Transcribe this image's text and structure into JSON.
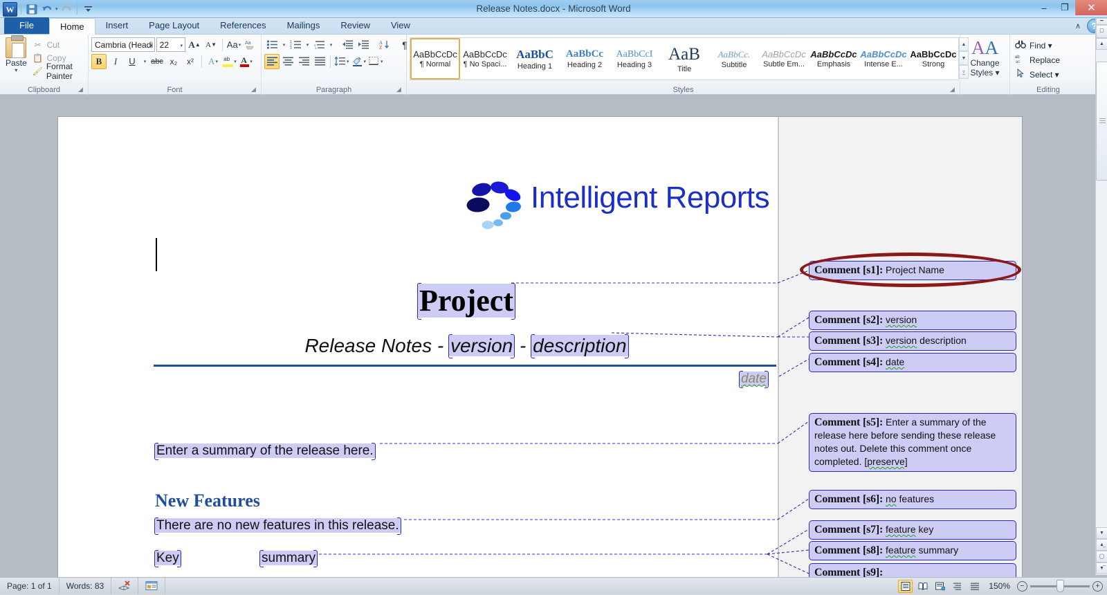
{
  "window": {
    "title": "Release Notes.docx  -  Microsoft Word",
    "minimize": "–",
    "restore": "❐",
    "close": "✕",
    "help": "?",
    "collapse_ribbon": "∧"
  },
  "quick_access": {
    "app_logo": "W",
    "save": "save-icon",
    "undo": "undo-icon",
    "redo": "redo-icon",
    "customize": "customize-icon"
  },
  "tabs": [
    {
      "label": "File",
      "kind": "file"
    },
    {
      "label": "Home",
      "kind": "active"
    },
    {
      "label": "Insert",
      "kind": "normal"
    },
    {
      "label": "Page Layout",
      "kind": "normal"
    },
    {
      "label": "References",
      "kind": "normal"
    },
    {
      "label": "Mailings",
      "kind": "normal"
    },
    {
      "label": "Review",
      "kind": "normal"
    },
    {
      "label": "View",
      "kind": "normal"
    }
  ],
  "ribbon": {
    "clipboard": {
      "group_label": "Clipboard",
      "paste": "Paste",
      "paste_arrow": "▾",
      "cut": "Cut",
      "copy": "Copy",
      "format_painter": "Format Painter"
    },
    "font": {
      "group_label": "Font",
      "font_name": "Cambria (Headi",
      "font_size": "22",
      "grow_font": "A",
      "shrink_font": "A",
      "change_case": "Aa",
      "clear_formatting": "clear-formatting-icon",
      "bold": "B",
      "italic": "I",
      "underline": "U",
      "strikethrough": "abc",
      "subscript": "x₂",
      "superscript": "x²",
      "text_effects": "A",
      "highlight": "ab",
      "font_color": "A"
    },
    "paragraph": {
      "group_label": "Paragraph",
      "bullets": "bullets-icon",
      "numbering": "numbering-icon",
      "multilevel": "multilevel-list-icon",
      "decrease_indent": "decrease-indent-icon",
      "increase_indent": "increase-indent-icon",
      "sort": "sort-icon",
      "show_marks": "¶",
      "align_left": "align-left-icon",
      "align_center": "align-center-icon",
      "align_right": "align-right-icon",
      "justify": "justify-icon",
      "line_spacing": "line-spacing-icon",
      "shading": "shading-icon",
      "borders": "borders-icon"
    },
    "styles": {
      "group_label": "Styles",
      "items": [
        {
          "preview": "AaBbCcDc",
          "name": "¶ Normal",
          "selected": true
        },
        {
          "preview": "AaBbCcDc",
          "name": "¶ No Spaci...",
          "selected": false
        },
        {
          "preview": "AaBbC",
          "name": "Heading 1",
          "selected": false
        },
        {
          "preview": "AaBbCc",
          "name": "Heading 2",
          "selected": false
        },
        {
          "preview": "AaBbCcI",
          "name": "Heading 3",
          "selected": false
        },
        {
          "preview": "AaB",
          "name": "Title",
          "selected": false
        },
        {
          "preview": "AaBbCc.",
          "name": "Subtitle",
          "selected": false
        },
        {
          "preview": "AaBbCcDc",
          "name": "Subtle Em...",
          "selected": false
        },
        {
          "preview": "AaBbCcDc",
          "name": "Emphasis",
          "selected": false
        },
        {
          "preview": "AaBbCcDc",
          "name": "Intense E...",
          "selected": false
        },
        {
          "preview": "AaBbCcDc",
          "name": "Strong",
          "selected": false
        }
      ],
      "change_styles": "Change\nStyles"
    },
    "change_styles": {
      "line1": "Change",
      "line2": "Styles ▾"
    },
    "editing": {
      "group_label": "Editing",
      "find": "Find ▾",
      "replace": "Replace",
      "select": "Select ▾"
    }
  },
  "document": {
    "logo_text": "Intelligent Reports",
    "title": "Project",
    "subtitle_pre": "Release Notes - ",
    "subtitle_version": "version",
    "subtitle_mid": " - ",
    "subtitle_description": "description",
    "date": "date",
    "summary": "Enter a summary of the release here.",
    "heading_new_features": "New Features",
    "no_features": "There are no new features in this release.",
    "key": "Key",
    "summary_col": "summary"
  },
  "comments": [
    {
      "label": "Comment [s1]:",
      "text": "Project Name",
      "squiggle": ""
    },
    {
      "label": "Comment [s2]:",
      "text": "",
      "squiggle": "version"
    },
    {
      "label": "Comment [s3]:",
      "text": " description",
      "squiggle": "version"
    },
    {
      "label": "Comment [s4]:",
      "text": "",
      "squiggle": "date"
    },
    {
      "label": "Comment [s5]:",
      "text": "Enter a summary of the release here before sending these release notes out.  Delete this comment once completed.",
      "squiggle": "[preserve]"
    },
    {
      "label": "Comment [s6]:",
      "text": " features",
      "squiggle": "no"
    },
    {
      "label": "Comment [s7]:",
      "text": " key",
      "squiggle": "feature"
    },
    {
      "label": "Comment [s8]:",
      "text": " summary",
      "squiggle": "feature"
    },
    {
      "label": "Comment [s9]:",
      "text": "",
      "squiggle": ""
    }
  ],
  "status_bar": {
    "page": "Page: 1 of 1",
    "words": "Words: 83",
    "proofing": "proofing-errors-icon",
    "track_changes": "track-changes-icon",
    "views": [
      {
        "name": "print-layout-view",
        "glyph": "≡",
        "selected": true
      },
      {
        "name": "full-screen-reading-view",
        "glyph": "◫",
        "selected": false
      },
      {
        "name": "web-layout-view",
        "glyph": "▤",
        "selected": false
      },
      {
        "name": "outline-view",
        "glyph": "≣",
        "selected": false
      },
      {
        "name": "draft-view",
        "glyph": "☰",
        "selected": false
      }
    ],
    "zoom": "150%",
    "zoom_out": "−",
    "zoom_in": "+"
  },
  "colors": {
    "accent_blue": "#1f4e9c",
    "logo_blue": "#1b2ec8",
    "comment_fill": "#ccccf5",
    "comment_border": "#2b2bbb",
    "annotation_red": "#8c1818",
    "spell_green": "#21a021"
  }
}
